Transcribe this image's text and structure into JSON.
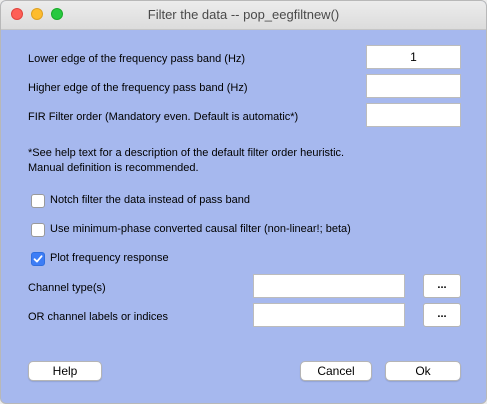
{
  "window": {
    "title": "Filter the data -- pop_eegfiltnew()"
  },
  "fields": {
    "lower_edge": {
      "label": "Lower edge of the frequency pass band (Hz)",
      "value": "1"
    },
    "higher_edge": {
      "label": "Higher edge of the frequency pass band (Hz)",
      "value": ""
    },
    "filter_order": {
      "label": "FIR Filter order (Mandatory even. Default is automatic*)",
      "value": ""
    }
  },
  "note": {
    "line1": "*See help text for a description of the default filter order heuristic.",
    "line2": "Manual definition is recommended."
  },
  "options": {
    "notch": {
      "label": "Notch filter the data instead of pass band",
      "checked": false
    },
    "minphase": {
      "label": "Use minimum-phase converted causal filter (non-linear!; beta)",
      "checked": false
    },
    "plot": {
      "label": "Plot frequency response",
      "checked": true
    }
  },
  "channels": {
    "type": {
      "label": "Channel type(s)",
      "value": "",
      "browse": "..."
    },
    "labels": {
      "label": "OR channel labels or indices",
      "value": "",
      "browse": "..."
    }
  },
  "buttons": {
    "help": "Help",
    "cancel": "Cancel",
    "ok": "Ok"
  },
  "colors": {
    "dialog_bg": "#a6b8ee",
    "checkbox_checked": "#3d7df6"
  }
}
